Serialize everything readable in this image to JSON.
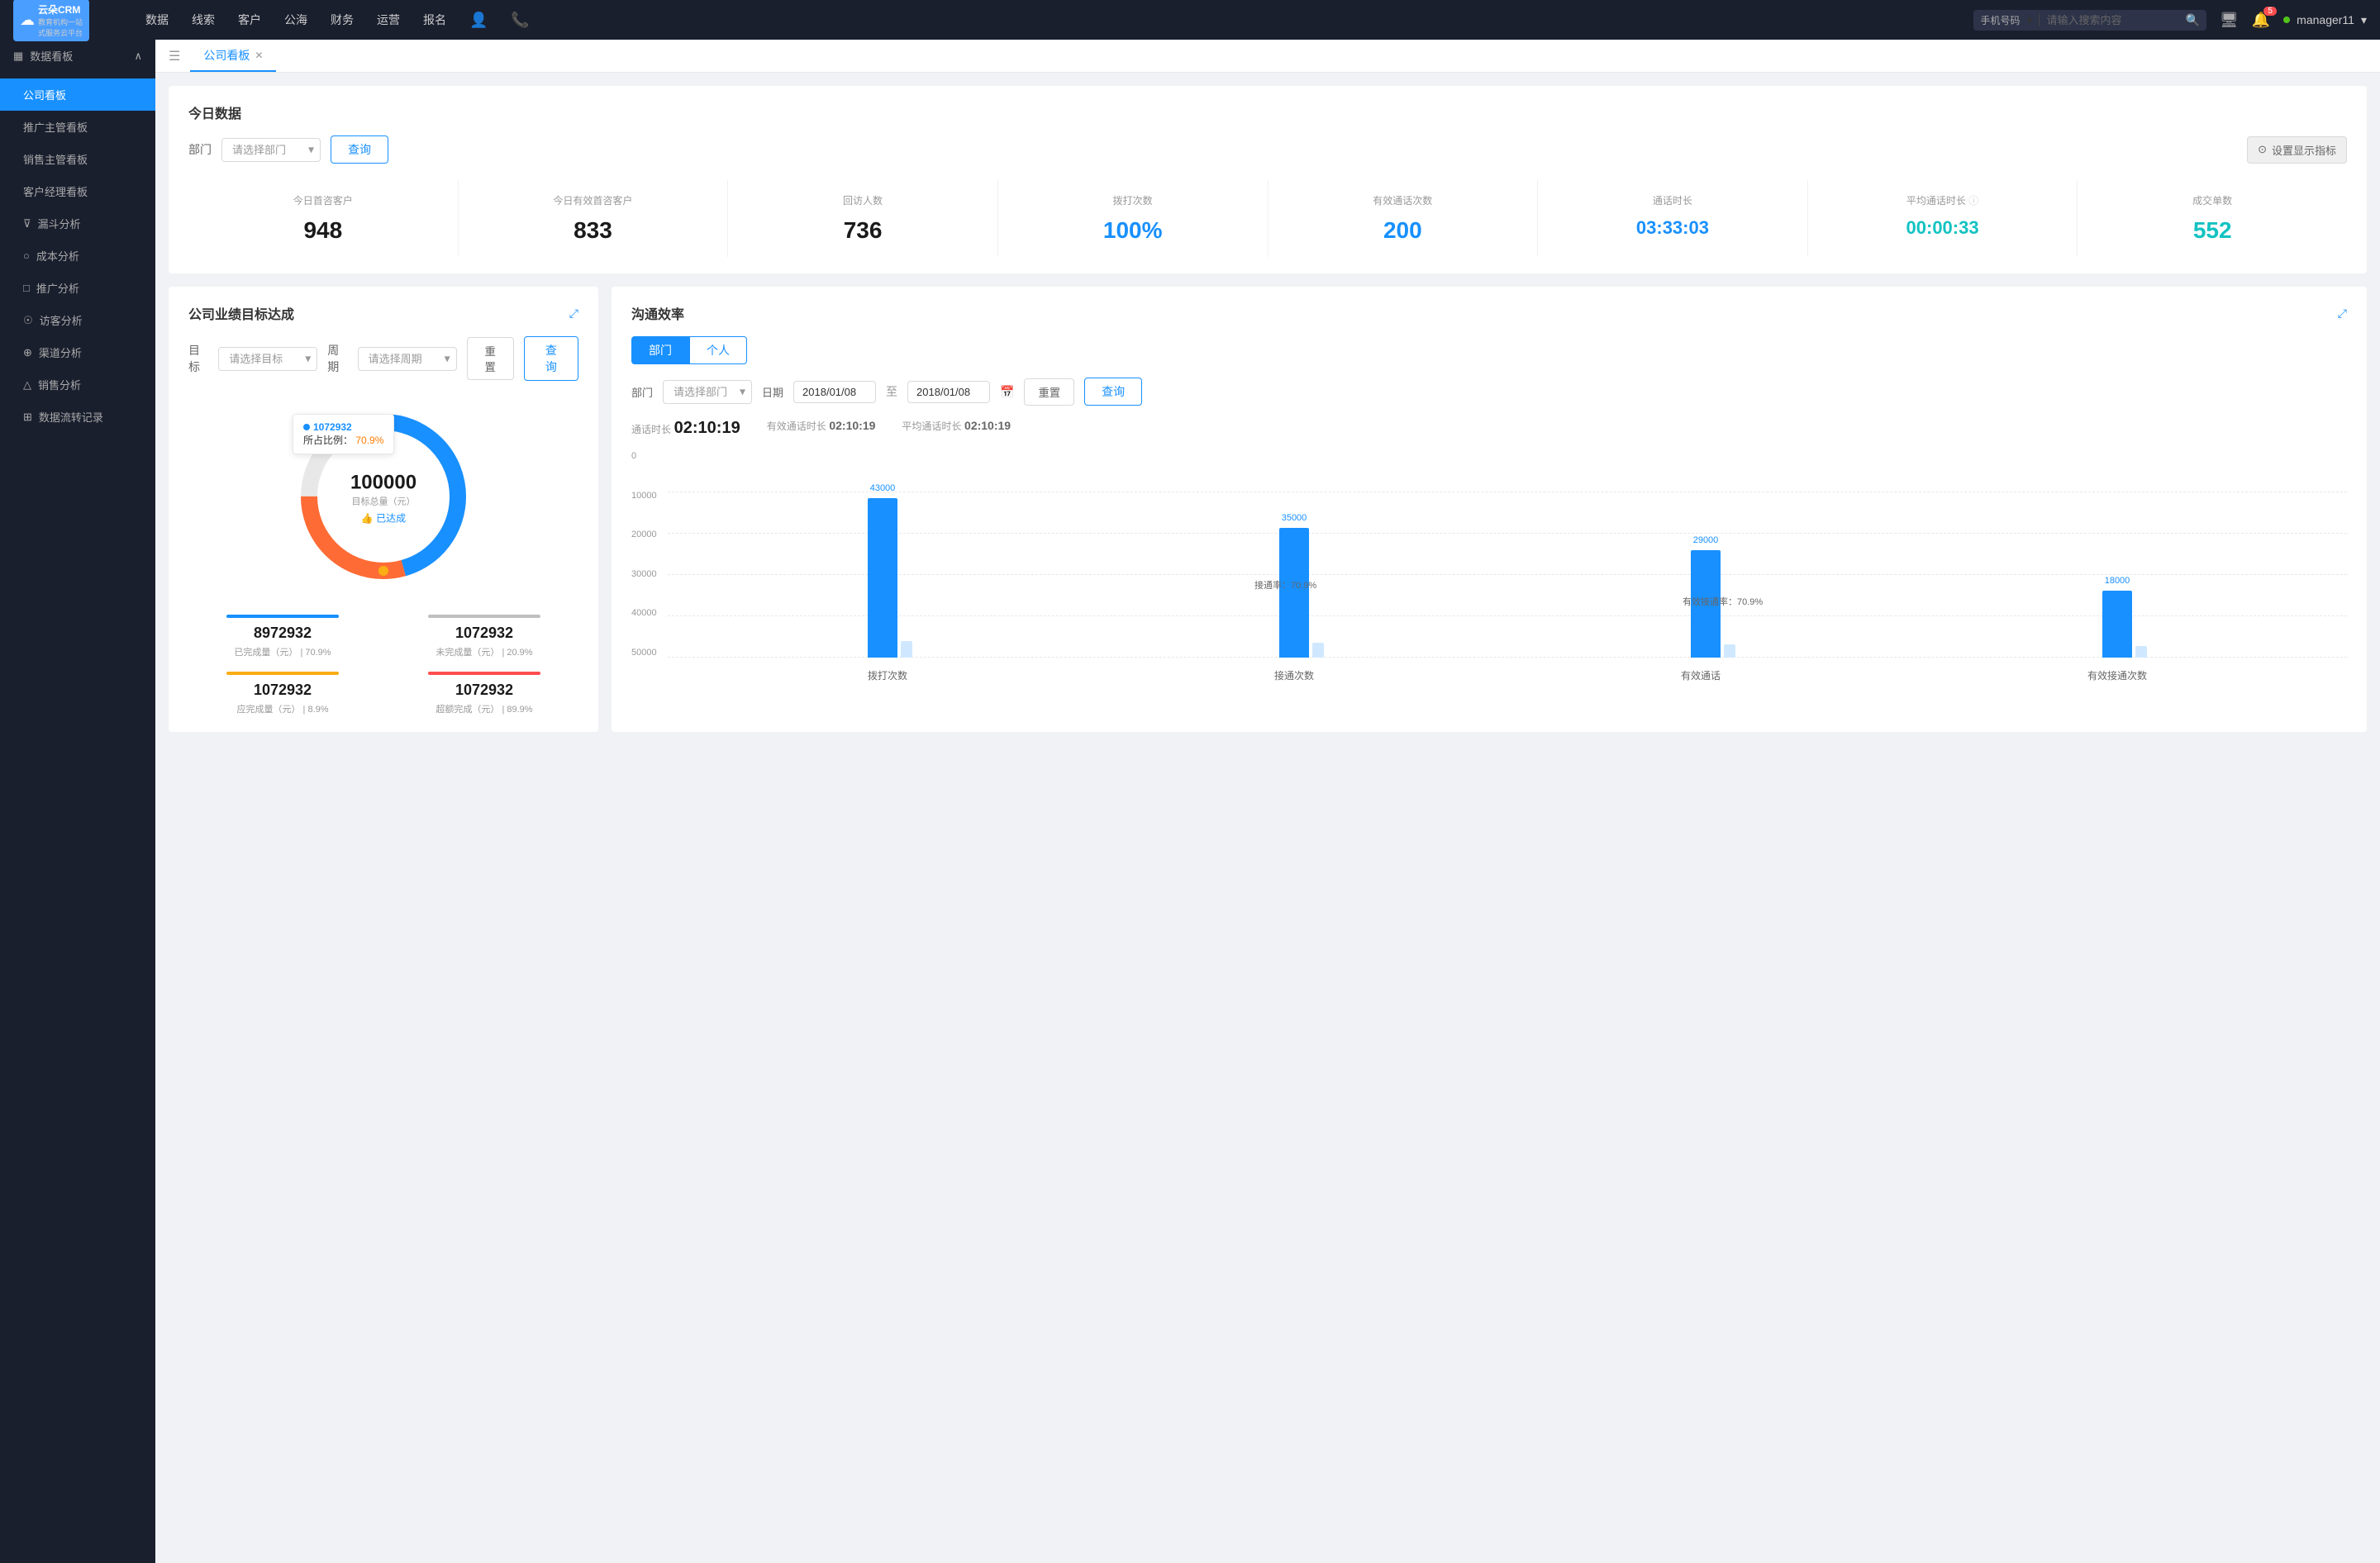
{
  "app": {
    "logo_text": "云朵CRM",
    "logo_sub1": "教育机构一站",
    "logo_sub2": "式服务云平台"
  },
  "nav": {
    "items": [
      "数据",
      "线索",
      "客户",
      "公海",
      "财务",
      "运营",
      "报名"
    ],
    "search_placeholder": "请输入搜索内容",
    "search_type": "手机号码",
    "notification_count": "5",
    "username": "manager11"
  },
  "sidebar": {
    "group_label": "数据看板",
    "items": [
      {
        "label": "公司看板",
        "active": true
      },
      {
        "label": "推广主管看板",
        "active": false
      },
      {
        "label": "销售主管看板",
        "active": false
      },
      {
        "label": "客户经理看板",
        "active": false
      },
      {
        "label": "漏斗分析",
        "active": false
      },
      {
        "label": "成本分析",
        "active": false
      },
      {
        "label": "推广分析",
        "active": false
      },
      {
        "label": "访客分析",
        "active": false
      },
      {
        "label": "渠道分析",
        "active": false
      },
      {
        "label": "销售分析",
        "active": false
      },
      {
        "label": "数据流转记录",
        "active": false
      }
    ]
  },
  "tab_bar": {
    "tab_label": "公司看板"
  },
  "today_section": {
    "title": "今日数据",
    "filter_label": "部门",
    "filter_placeholder": "请选择部门",
    "query_btn": "查询",
    "settings_btn": "设置显示指标",
    "stats": [
      {
        "label": "今日首咨客户",
        "value": "948",
        "color": "black"
      },
      {
        "label": "今日有效首咨客户",
        "value": "833",
        "color": "black"
      },
      {
        "label": "回访人数",
        "value": "736",
        "color": "black"
      },
      {
        "label": "拨打次数",
        "value": "100%",
        "color": "blue"
      },
      {
        "label": "有效通话次数",
        "value": "200",
        "color": "blue"
      },
      {
        "label": "通话时长",
        "value": "03:33:03",
        "color": "blue"
      },
      {
        "label": "平均通话时长",
        "value": "00:00:33",
        "color": "cyan"
      },
      {
        "label": "成交单数",
        "value": "552",
        "color": "cyan"
      }
    ]
  },
  "goal_panel": {
    "title": "公司业绩目标达成",
    "goal_label": "目标",
    "goal_placeholder": "请选择目标",
    "period_label": "周期",
    "period_placeholder": "请选择周期",
    "reset_btn": "重置",
    "query_btn": "查询",
    "tooltip_value": "1072932",
    "tooltip_pct_label": "所占比例：",
    "tooltip_pct": "70.9%",
    "donut_value": "100000",
    "donut_sub": "目标总量（元）",
    "donut_achieved": "👍 已达成",
    "stats": [
      {
        "bar_color": "#1890ff",
        "num": "8972932",
        "desc1": "已完成量（元）",
        "sep": "|",
        "desc2": "70.9%"
      },
      {
        "bar_color": "#c0c0c0",
        "num": "1072932",
        "desc1": "未完成量（元）",
        "sep": "|",
        "desc2": "20.9%"
      },
      {
        "bar_color": "#faad14",
        "num": "1072932",
        "desc1": "应完成量（元）",
        "sep": "|",
        "desc2": "8.9%"
      },
      {
        "bar_color": "#ff4d4f",
        "num": "1072932",
        "desc1": "超额完成（元）",
        "sep": "|",
        "desc2": "89.9%"
      }
    ]
  },
  "comm_panel": {
    "title": "沟通效率",
    "dept_tab": "部门",
    "personal_tab": "个人",
    "dept_label": "部门",
    "dept_placeholder": "请选择部门",
    "date_label": "日期",
    "date_start": "2018/01/08",
    "date_end": "2018/01/08",
    "reset_btn": "重置",
    "query_btn": "查询",
    "stats": [
      {
        "label": "通话时长",
        "value": "02:10:19"
      },
      {
        "label": "有效通话时长",
        "value": "02:10:19"
      },
      {
        "label": "平均通话时长",
        "value": "02:10:19"
      }
    ],
    "chart": {
      "y_labels": [
        "0",
        "10000",
        "20000",
        "30000",
        "40000",
        "50000"
      ],
      "groups": [
        {
          "label": "拨打次数",
          "bars": [
            {
              "value": 43000,
              "label": "43000",
              "color": "blue"
            },
            {
              "value": 0,
              "label": "",
              "color": "light"
            }
          ]
        },
        {
          "label": "接通次数",
          "rate": "接通率：70.9%",
          "bars": [
            {
              "value": 35000,
              "label": "35000",
              "color": "light"
            },
            {
              "value": 0,
              "label": "",
              "color": "blue"
            }
          ]
        },
        {
          "label": "有效通话",
          "rate": "有效接通率：70.9%",
          "bars": [
            {
              "value": 29000,
              "label": "29000",
              "color": "blue"
            },
            {
              "value": 0,
              "label": "",
              "color": "light"
            }
          ]
        },
        {
          "label": "有效接通次数",
          "bars": [
            {
              "value": 18000,
              "label": "18000",
              "color": "blue"
            },
            {
              "value": 0,
              "label": "",
              "color": "light"
            }
          ]
        }
      ]
    }
  }
}
